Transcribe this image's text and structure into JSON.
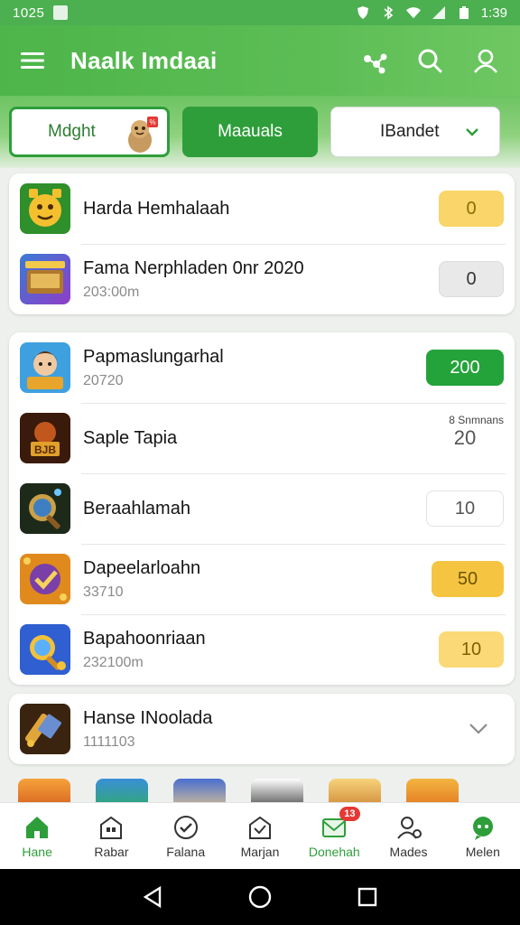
{
  "status_bar": {
    "time": "1025",
    "right_time": "1:39"
  },
  "app_bar": {
    "title": "Naalk Imdaai"
  },
  "filters": [
    {
      "label": "Mdght"
    },
    {
      "label": "Maauals"
    },
    {
      "label": "IBandet"
    }
  ],
  "card1": [
    {
      "title": "Harda Hemhalaah",
      "subtitle": "",
      "value": "0"
    },
    {
      "title": "Fama Nerphladen 0nr 2020",
      "subtitle": "203:00m",
      "value": "0"
    }
  ],
  "card2": [
    {
      "title": "Papmaslungarhal",
      "subtitle": "20720",
      "value": "200"
    },
    {
      "title": "Saple Tapia",
      "subtitle": "",
      "value": "20",
      "tag": "8 Snmnans"
    },
    {
      "title": "Beraahlamah",
      "subtitle": "",
      "value": "10"
    },
    {
      "title": "Dapeelarloahn",
      "subtitle": "33710",
      "value": "50"
    },
    {
      "title": "Bapahoonriaan",
      "subtitle": "232100m",
      "value": "10"
    }
  ],
  "card3": {
    "title": "Hanse INoolada",
    "subtitle": "1111103"
  },
  "bottom_nav": [
    {
      "label": "Hane"
    },
    {
      "label": "Rabar"
    },
    {
      "label": "Falana"
    },
    {
      "label": "Marjan"
    },
    {
      "label": "Donehah",
      "badge": "13"
    },
    {
      "label": "Mades"
    },
    {
      "label": "Melen"
    }
  ],
  "colors": {
    "primary": "#4caf50",
    "accent": "#2e9e3a",
    "yellow": "#f9d56a"
  }
}
